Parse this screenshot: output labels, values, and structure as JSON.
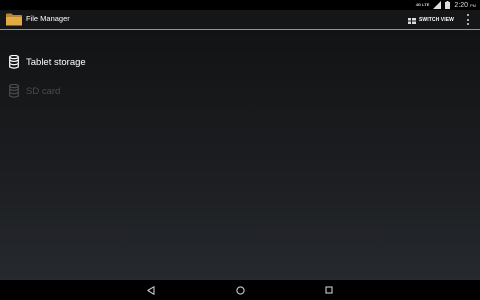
{
  "status_bar": {
    "network_type": "4G LTE",
    "time": "2:20",
    "time_suffix": "PM"
  },
  "action_bar": {
    "app_icon": "folder-icon",
    "title": "File Manager",
    "switch_view_label": "SWITCH VIEW",
    "switch_view_icon": "view-grid-icon",
    "overflow_icon": "overflow-menu-icon",
    "accent_color": "#c8902c"
  },
  "storage": {
    "items": [
      {
        "label": "Tablet storage",
        "icon": "database-icon",
        "enabled": true
      },
      {
        "label": "SD card",
        "icon": "database-icon",
        "enabled": false
      }
    ]
  },
  "nav_bar": {
    "back_icon": "back-triangle-icon",
    "home_icon": "home-circle-icon",
    "recents_icon": "recents-square-icon"
  }
}
